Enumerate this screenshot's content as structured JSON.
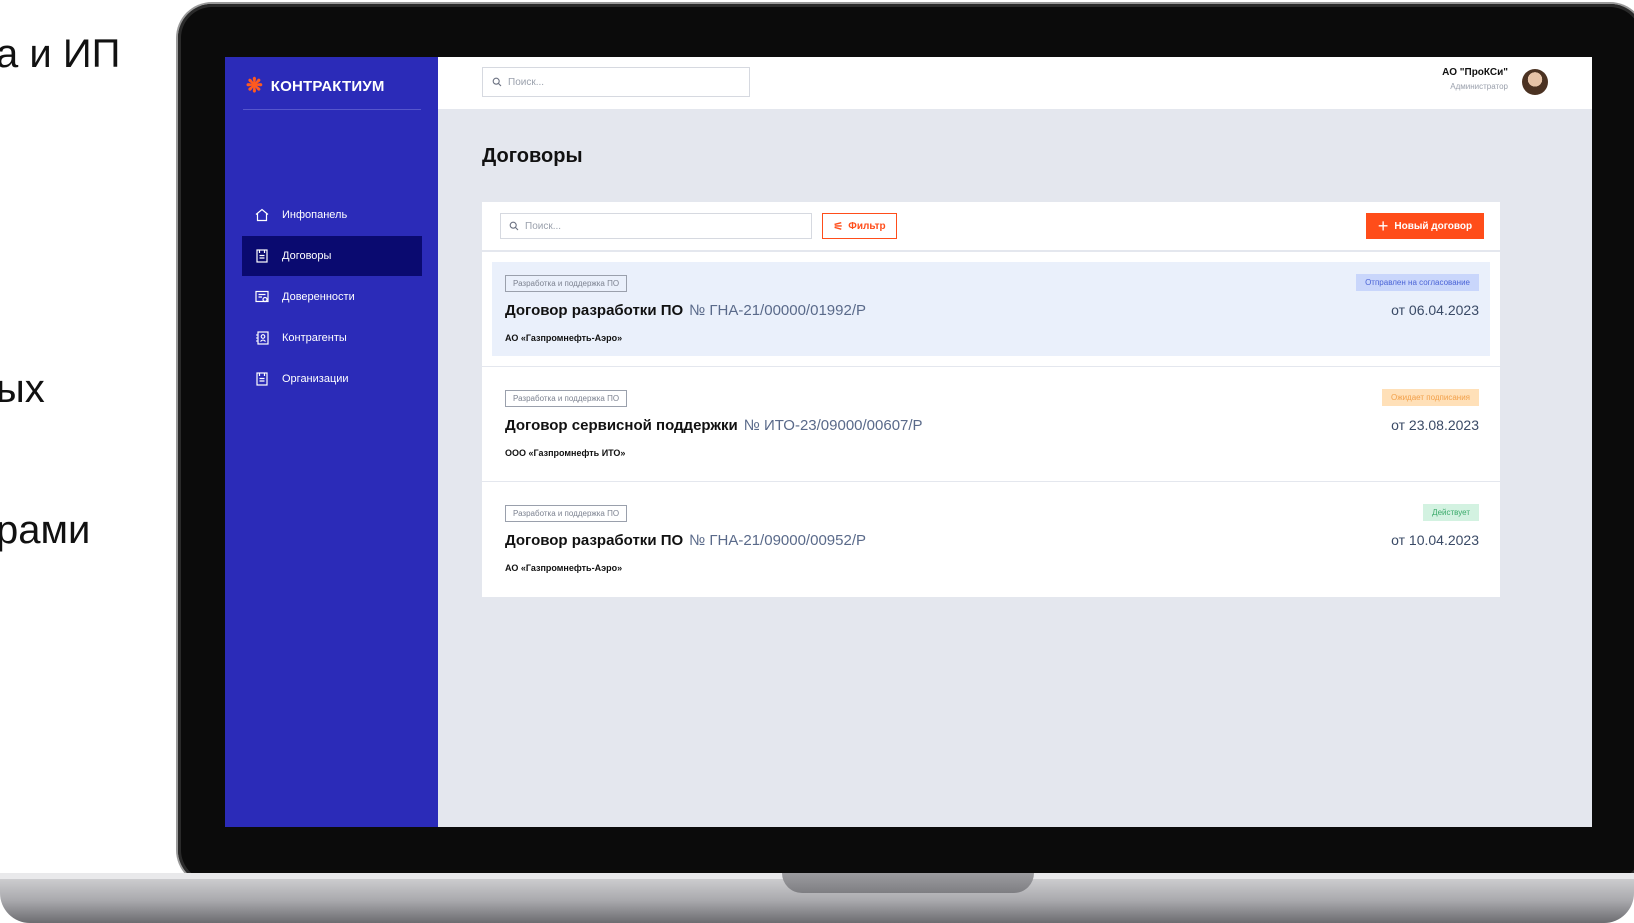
{
  "slide": {
    "line1": "а и ИП",
    "line2": "ых",
    "line3": "рами"
  },
  "app": {
    "logo_text": "КОНТРАКТИУМ",
    "logo_mark": "❋"
  },
  "sidebar": {
    "items": [
      {
        "label": "Инфопанель",
        "icon": "home-icon"
      },
      {
        "label": "Договоры",
        "icon": "document-icon"
      },
      {
        "label": "Доверенности",
        "icon": "certificate-icon"
      },
      {
        "label": "Контрагенты",
        "icon": "contacts-icon"
      },
      {
        "label": "Организации",
        "icon": "document-icon"
      }
    ],
    "active_index": 1
  },
  "topbar": {
    "search_placeholder": "Поиск...",
    "org_name": "АО \"ПроКСи\"",
    "org_role": "Администратор"
  },
  "main": {
    "title": "Договоры",
    "search_placeholder": "Поиск...",
    "filter_label": "Фильтр",
    "new_label": "Новый договор"
  },
  "contracts": [
    {
      "tag": "Разработка и поддержка ПО",
      "name": "Договор разработки ПО",
      "number": "№ ГНА-21/00000/01992/Р",
      "org": "АО «Газпромнефть-Аэро»",
      "status": "Отправлен на согласование",
      "date": "от 06.04.2023"
    },
    {
      "tag": "Разработка и поддержка ПО",
      "name": "Договор сервисной поддержки",
      "number": "№ ИТО-23/09000/00607/Р",
      "org": "ООО «Газпромнефть ИТО»",
      "status": "Ожидает подписания",
      "date": "от 23.08.2023"
    },
    {
      "tag": "Разработка и поддержка ПО",
      "name": "Договор разработки ПО",
      "number": "№ ГНА-21/09000/00952/Р",
      "org": "АО «Газпромнефть-Аэро»",
      "status": "Действует",
      "date": "от 10.04.2023"
    }
  ],
  "colors": {
    "sidebar": "#2b2bb8",
    "sidebar_active": "#0a0a70",
    "accent": "#ff4d1a",
    "status_review_bg": "#c9d6fb",
    "status_review_fg": "#4a63d6",
    "status_waiting_bg": "#ffe0b8",
    "status_waiting_fg": "#f2a04a",
    "status_active_bg": "#d3f2e1",
    "status_active_fg": "#3aaa6a"
  }
}
